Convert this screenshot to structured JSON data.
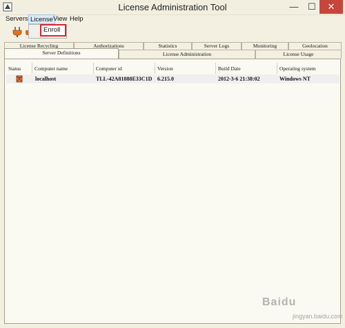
{
  "window": {
    "title": "License Administration Tool",
    "minimize": "—",
    "maximize": "☐",
    "close": "✕"
  },
  "menubar": {
    "items": [
      "Servers",
      "License",
      "View",
      "Help"
    ]
  },
  "dropdown": {
    "items": [
      "Enroll"
    ]
  },
  "tabs": {
    "back_row": [
      "License Recycling",
      "Authorizations",
      "Statistics",
      "Server Logs",
      "Monitoring",
      "Geolocation"
    ],
    "front_row": [
      "Server Definitions",
      "License Administration",
      "License Usage"
    ],
    "active": "Server Definitions"
  },
  "table": {
    "columns": [
      "Status",
      "Computer name",
      "Computer id",
      "Version",
      "Build Date",
      "Operating system"
    ],
    "rows": [
      {
        "status_icon": "server-disconnected-icon",
        "computer_name": "localhost",
        "computer_id": "TLL-42A81888E33C1D",
        "version": "6.215.0",
        "build_date": "2012-3-6 21:38:02",
        "os": "Windows NT"
      }
    ]
  },
  "watermark": {
    "text": "Baidu",
    "sub": "jingyan.baidu.com"
  },
  "colors": {
    "highlight_border": "#d7262a",
    "menu_active_bg": "#dcebfb",
    "close_button": "#c7463c"
  }
}
